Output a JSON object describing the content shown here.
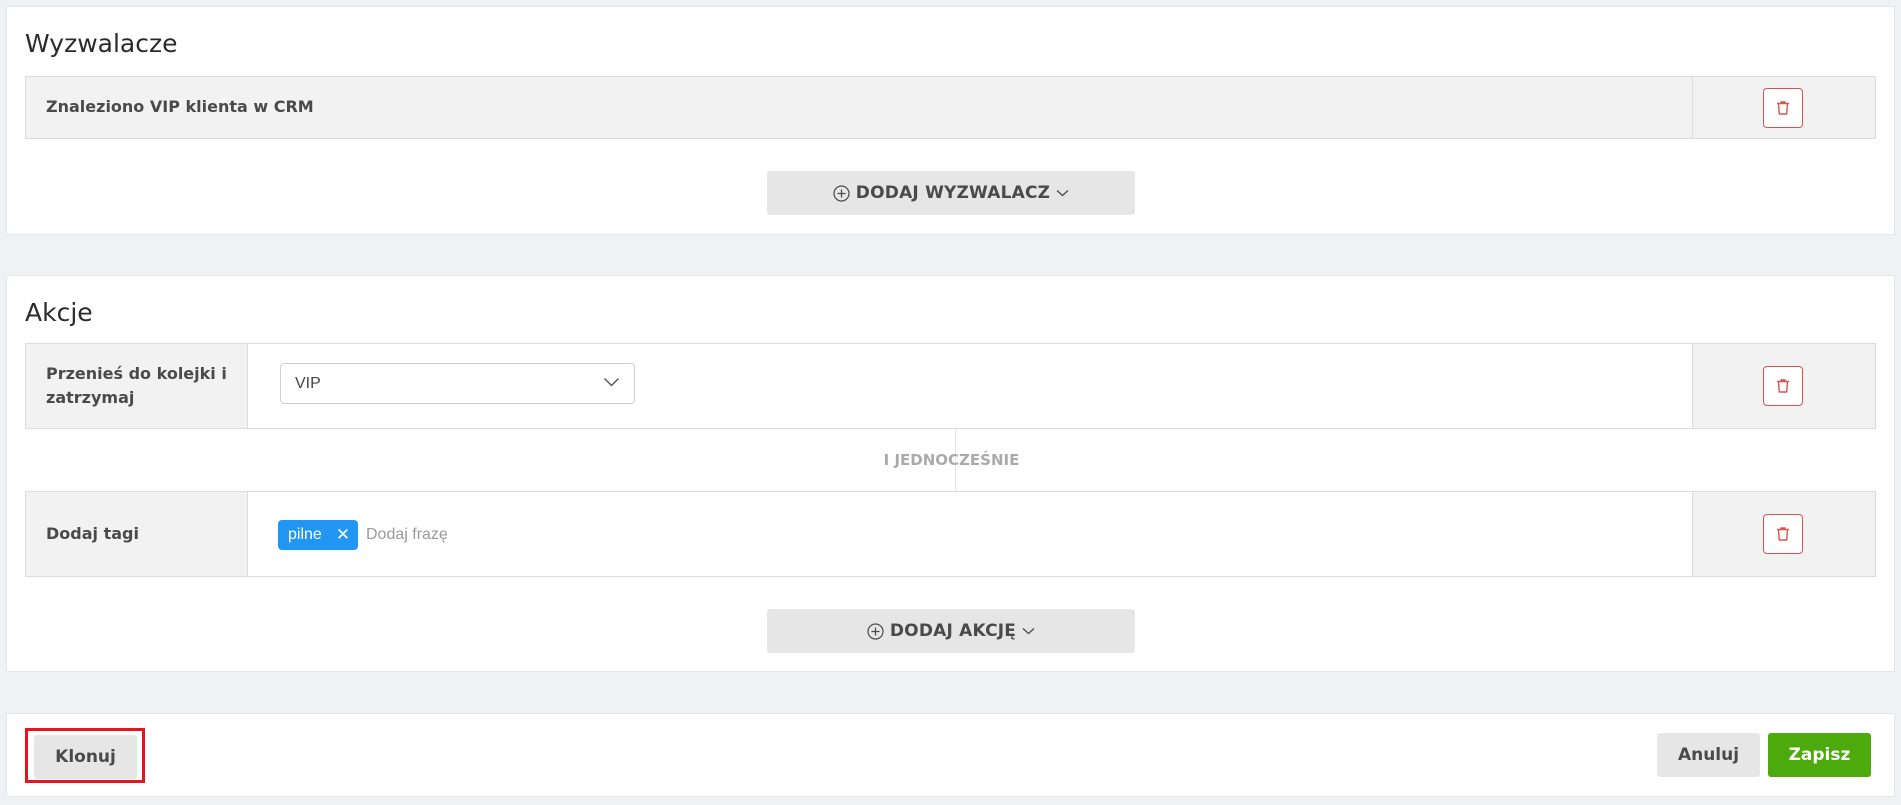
{
  "triggers": {
    "title": "Wyzwalacze",
    "items": [
      {
        "label": "Znaleziono VIP klienta w CRM"
      }
    ],
    "add_button_label": "DODAJ WYZWALACZ"
  },
  "actions": {
    "title": "Akcje",
    "items": [
      {
        "label": "Przenieś do kolejki i zatrzymaj",
        "select_value": "VIP"
      },
      {
        "label": "Dodaj tagi",
        "tags": [
          "pilne"
        ],
        "input_placeholder": "Dodaj frazę"
      }
    ],
    "connector_label": "I JEDNOCZEŚNIE",
    "add_button_label": "DODAJ AKCJĘ"
  },
  "footer": {
    "clone_label": "Klonuj",
    "cancel_label": "Anuluj",
    "save_label": "Zapisz"
  },
  "colors": {
    "delete_accent": "#d9534f",
    "tag_blue": "#2196f3",
    "save_green": "#4caa0d",
    "highlight_red": "#e8131c"
  },
  "icons": {
    "delete": "trash-icon",
    "add": "plus-circle-icon",
    "dropdown": "chevron-down-icon",
    "remove_tag": "close-icon"
  }
}
